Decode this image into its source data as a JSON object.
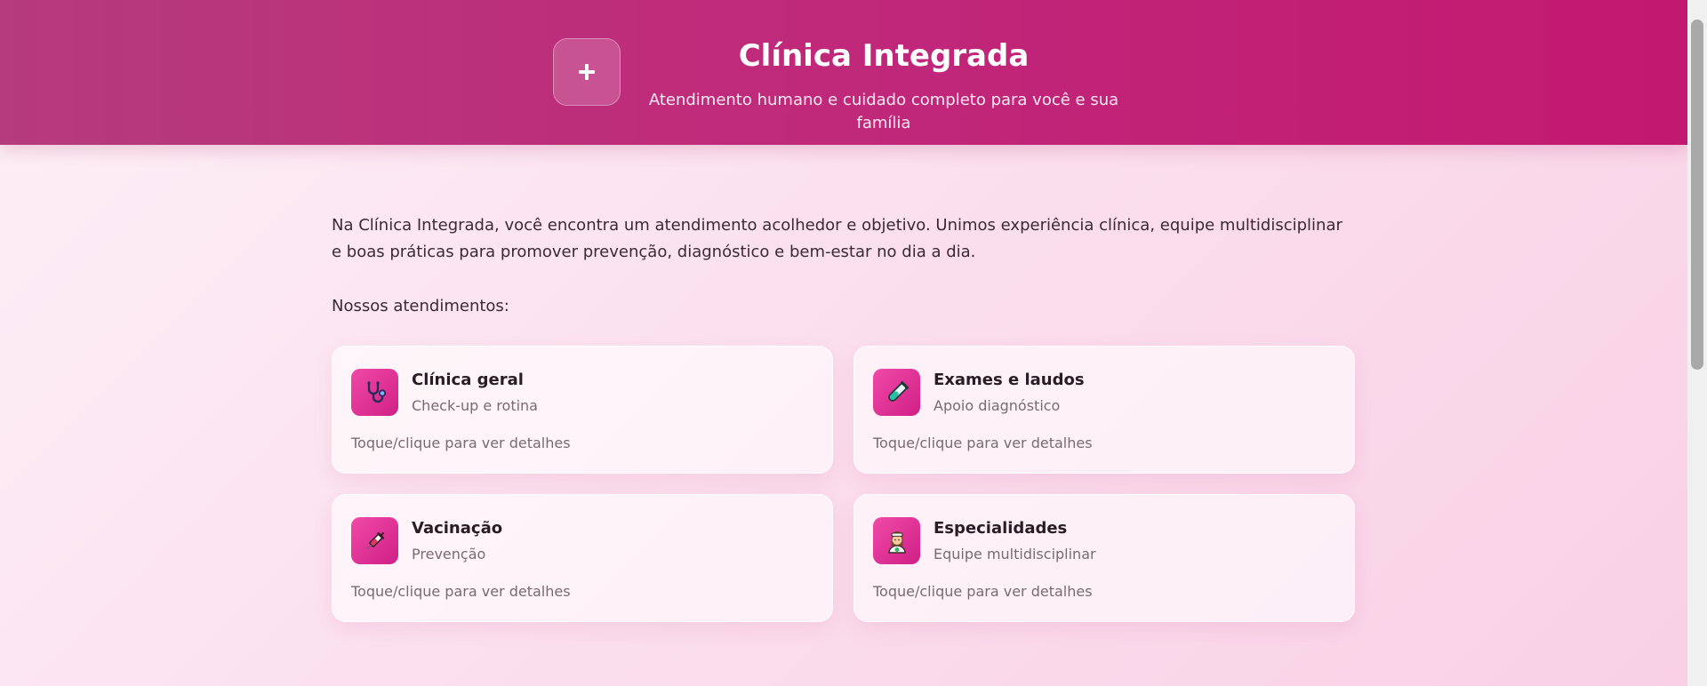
{
  "header": {
    "title": "Clínica Integrada",
    "subtitle": "Atendimento humano e cuidado completo para você e sua família",
    "logo_icon": "plus-icon"
  },
  "main": {
    "intro": "Na Clínica Integrada, você encontra um atendimento acolhedor e objetivo. Unimos experiência clínica, equipe multidisciplinar e boas práticas para promover prevenção, diagnóstico e bem-estar no dia a dia.",
    "section_label": "Nossos atendimentos:",
    "cards": [
      {
        "title": "Clínica geral",
        "subtitle": "Check-up e rotina",
        "hint": "Toque/clique para ver detalhes",
        "icon": "stethoscope-icon"
      },
      {
        "title": "Exames e laudos",
        "subtitle": "Apoio diagnóstico",
        "hint": "Toque/clique para ver detalhes",
        "icon": "test-tube-icon"
      },
      {
        "title": "Vacinação",
        "subtitle": "Prevenção",
        "hint": "Toque/clique para ver detalhes",
        "icon": "syringe-icon"
      },
      {
        "title": "Especialidades",
        "subtitle": "Equipe multidisciplinar",
        "hint": "Toque/clique para ver detalhes",
        "icon": "health-worker-icon"
      }
    ]
  },
  "colors": {
    "header_start": "#b53b7c",
    "header_end": "#c21870",
    "accent": "#e0339a",
    "background": "#fbe0ee"
  }
}
